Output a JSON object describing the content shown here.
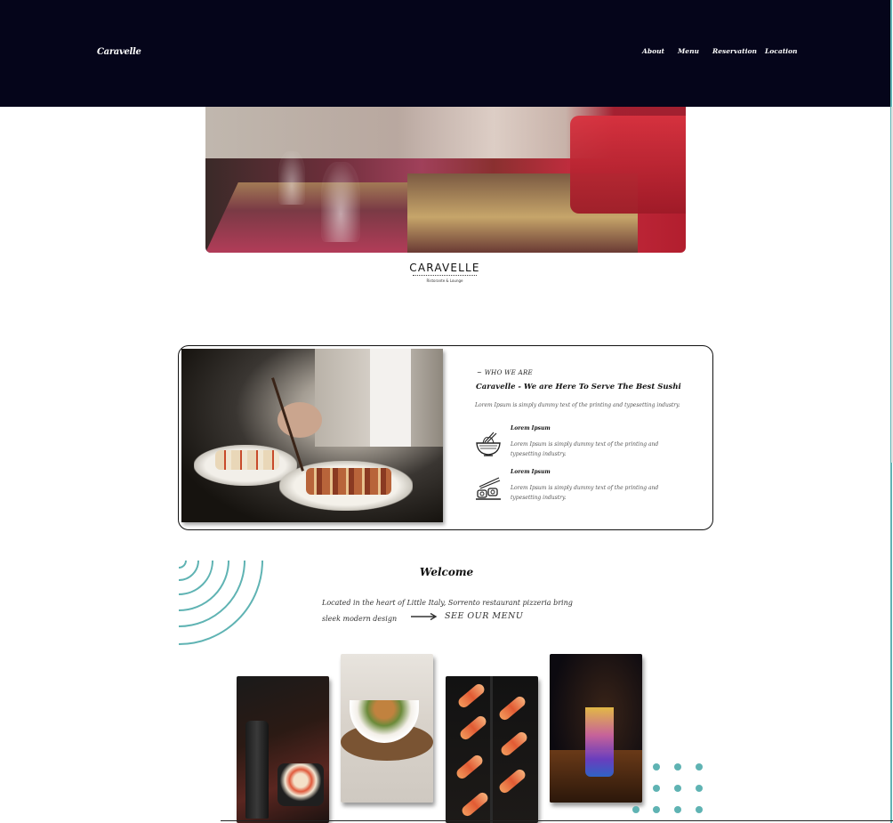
{
  "header": {
    "logo": "Caravelle",
    "nav": [
      "About",
      "Menu",
      "Reservation",
      "Location"
    ]
  },
  "hero": {
    "brand_name": "CARAVELLE",
    "brand_sub": "Ristorante & Lounge"
  },
  "about": {
    "eyebrow": "~ WHO WE ARE",
    "title": "Caravelle - We are Here To Serve The Best Sushi",
    "description": "Lorem Ipsum is simply dummy text of the printing and typesetting industry.",
    "features": [
      {
        "icon": "ramen-bowl-icon",
        "title": "Lorem Ipsum",
        "text": "Lorem Ipsum is simply dummy text of the printing and typesetting industry."
      },
      {
        "icon": "sushi-chopsticks-icon",
        "title": "Lorem Ipsum",
        "text": "Lorem Ipsum is simply dummy text of the printing and typesetting industry."
      }
    ]
  },
  "welcome": {
    "title": "Welcome",
    "text": "Located in the heart of Little Italy, Sorrento restaurant pizzeria bring sleek modern design",
    "menu_link": "SEE OUR MENU"
  },
  "colors": {
    "header_bg": "#05051a",
    "accent_teal": "#5fb3b3"
  }
}
